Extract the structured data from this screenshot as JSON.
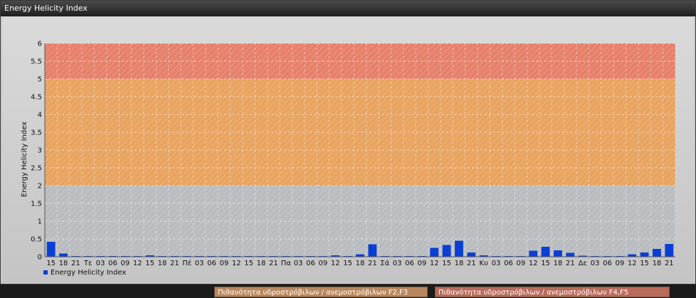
{
  "window": {
    "title": "Energy Helicity Index"
  },
  "legend": {
    "series_label": "Energy Helicity Index",
    "series_color": "#0a3fd6"
  },
  "bands": [
    {
      "label": "Πιθανότητα υδροστρόβιλων / ανεμοστρόβιλων F2,F3",
      "from": 2,
      "to": 5,
      "color": "#e8a35f"
    },
    {
      "label": "Πιθανότητα υδροστρόβιλων / ανεμοστρόβιλων F4,F5",
      "from": 5,
      "to": 6,
      "color": "#e6806a"
    }
  ],
  "chart_data": {
    "type": "bar",
    "title": "",
    "ylabel": "Energy Helicity Index",
    "xlabel": "",
    "ylim": [
      0,
      6
    ],
    "yticks": [
      "0",
      "0.5",
      "1",
      "1.5",
      "2",
      "2.5",
      "3",
      "3.5",
      "4",
      "4.5",
      "5",
      "5.5",
      "6"
    ],
    "grid": true,
    "categories": [
      "15",
      "18",
      "21",
      "Τε",
      "03",
      "06",
      "09",
      "12",
      "15",
      "18",
      "21",
      "Πέ",
      "03",
      "06",
      "09",
      "12",
      "15",
      "18",
      "21",
      "Πα",
      "03",
      "06",
      "09",
      "12",
      "15",
      "18",
      "21",
      "Σά",
      "03",
      "06",
      "09",
      "12",
      "15",
      "18",
      "21",
      "Κυ",
      "03",
      "06",
      "09",
      "12",
      "15",
      "18",
      "21",
      "Δε",
      "03",
      "06",
      "09",
      "12",
      "15",
      "18",
      "21"
    ],
    "series": [
      {
        "name": "Energy Helicity Index",
        "values": [
          0.42,
          0.09,
          0.02,
          0.02,
          0.02,
          0.02,
          0.02,
          0.02,
          0.04,
          0.02,
          0.02,
          0.02,
          0.02,
          0.02,
          0.02,
          0.02,
          0.02,
          0.02,
          0.02,
          0.02,
          0.02,
          0.02,
          0.02,
          0.04,
          0.02,
          0.07,
          0.35,
          0.02,
          0.02,
          0.02,
          0.02,
          0.25,
          0.33,
          0.45,
          0.12,
          0.04,
          0.02,
          0.02,
          0.02,
          0.17,
          0.28,
          0.18,
          0.11,
          0.03,
          0.02,
          0.02,
          0.02,
          0.07,
          0.12,
          0.22,
          0.36
        ]
      }
    ]
  }
}
